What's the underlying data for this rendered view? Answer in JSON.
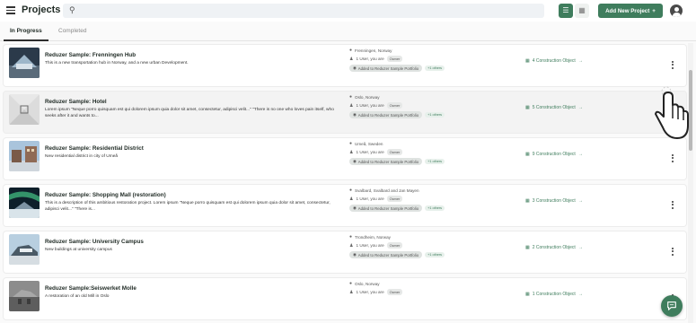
{
  "header": {
    "title": "Projects",
    "search_placeholder": "",
    "add_button_label": "Add New Project",
    "add_button_icon": "+"
  },
  "tabs": [
    {
      "label": "In Progress",
      "active": true
    },
    {
      "label": "Completed",
      "active": false
    }
  ],
  "colors": {
    "accent": "#3f7d5d",
    "background": "#fafafa"
  },
  "projects": [
    {
      "name": "Reduzer Sample: Frenningen Hub",
      "description": "This is a new transportation hub in Norway, and a new urban Development.",
      "location": "Frenningen, Norway",
      "users": "1 User, you are",
      "role": "Owner",
      "portfolio": "Added to Reduzer Sample Portfolio",
      "others": "+1 others",
      "construction": "4 Construction Object"
    },
    {
      "name": "Reduzer Sample: Hotel",
      "description": "Lorem ipsum \"Neque porro quisquam est qui dolorem ipsum quia dolor sit amet, consectetur, adipisci velit...\" \"There is no one who loves pain itself, who seeks after it and wants to...",
      "location": "Oslo, Norway",
      "users": "1 User, you are",
      "role": "Owner",
      "portfolio": "Added to Reduzer Sample Portfolio",
      "others": "+1 others",
      "construction": "5 Construction Object"
    },
    {
      "name": "Reduzer Sample: Residential District",
      "description": "New residential district in city of Umeå",
      "location": "Umeå, Sweden",
      "users": "1 User, you are",
      "role": "Owner",
      "portfolio": "Added to Reduzer Sample Portfolio",
      "others": "+1 others",
      "construction": "9 Construction Object"
    },
    {
      "name": "Reduzer Sample: Shopping Mall (restoration)",
      "description": "This is a description of this ambitious restoration project. Lorem ipsum \"Neque porro quisquam est qui dolorem ipsum quia dolor sit amet, consectetur, adipisci velit...\" \"There is...",
      "location": "Svalbard, Svalbard and Jan Mayen",
      "users": "1 User, you are",
      "role": "Owner",
      "portfolio": "Added to Reduzer Sample Portfolio",
      "others": "+1 others",
      "construction": "3 Construction Object"
    },
    {
      "name": "Reduzer Sample: University Campus",
      "description": "New buildings at university campus",
      "location": "Trondheim, Norway",
      "users": "1 User, you are",
      "role": "Owner",
      "portfolio": "Added to Reduzer Sample Portfolio",
      "others": "+1 others",
      "construction": "2 Construction Object"
    },
    {
      "name": "Reduzer Sample:Seiswerket Molle",
      "description": "A restoration of an old Mill in Oslo",
      "location": "Oslo, Norway",
      "users": "1 User, you are",
      "role": "Owner",
      "portfolio": "",
      "others": "",
      "construction": "1 Construction Object"
    }
  ]
}
